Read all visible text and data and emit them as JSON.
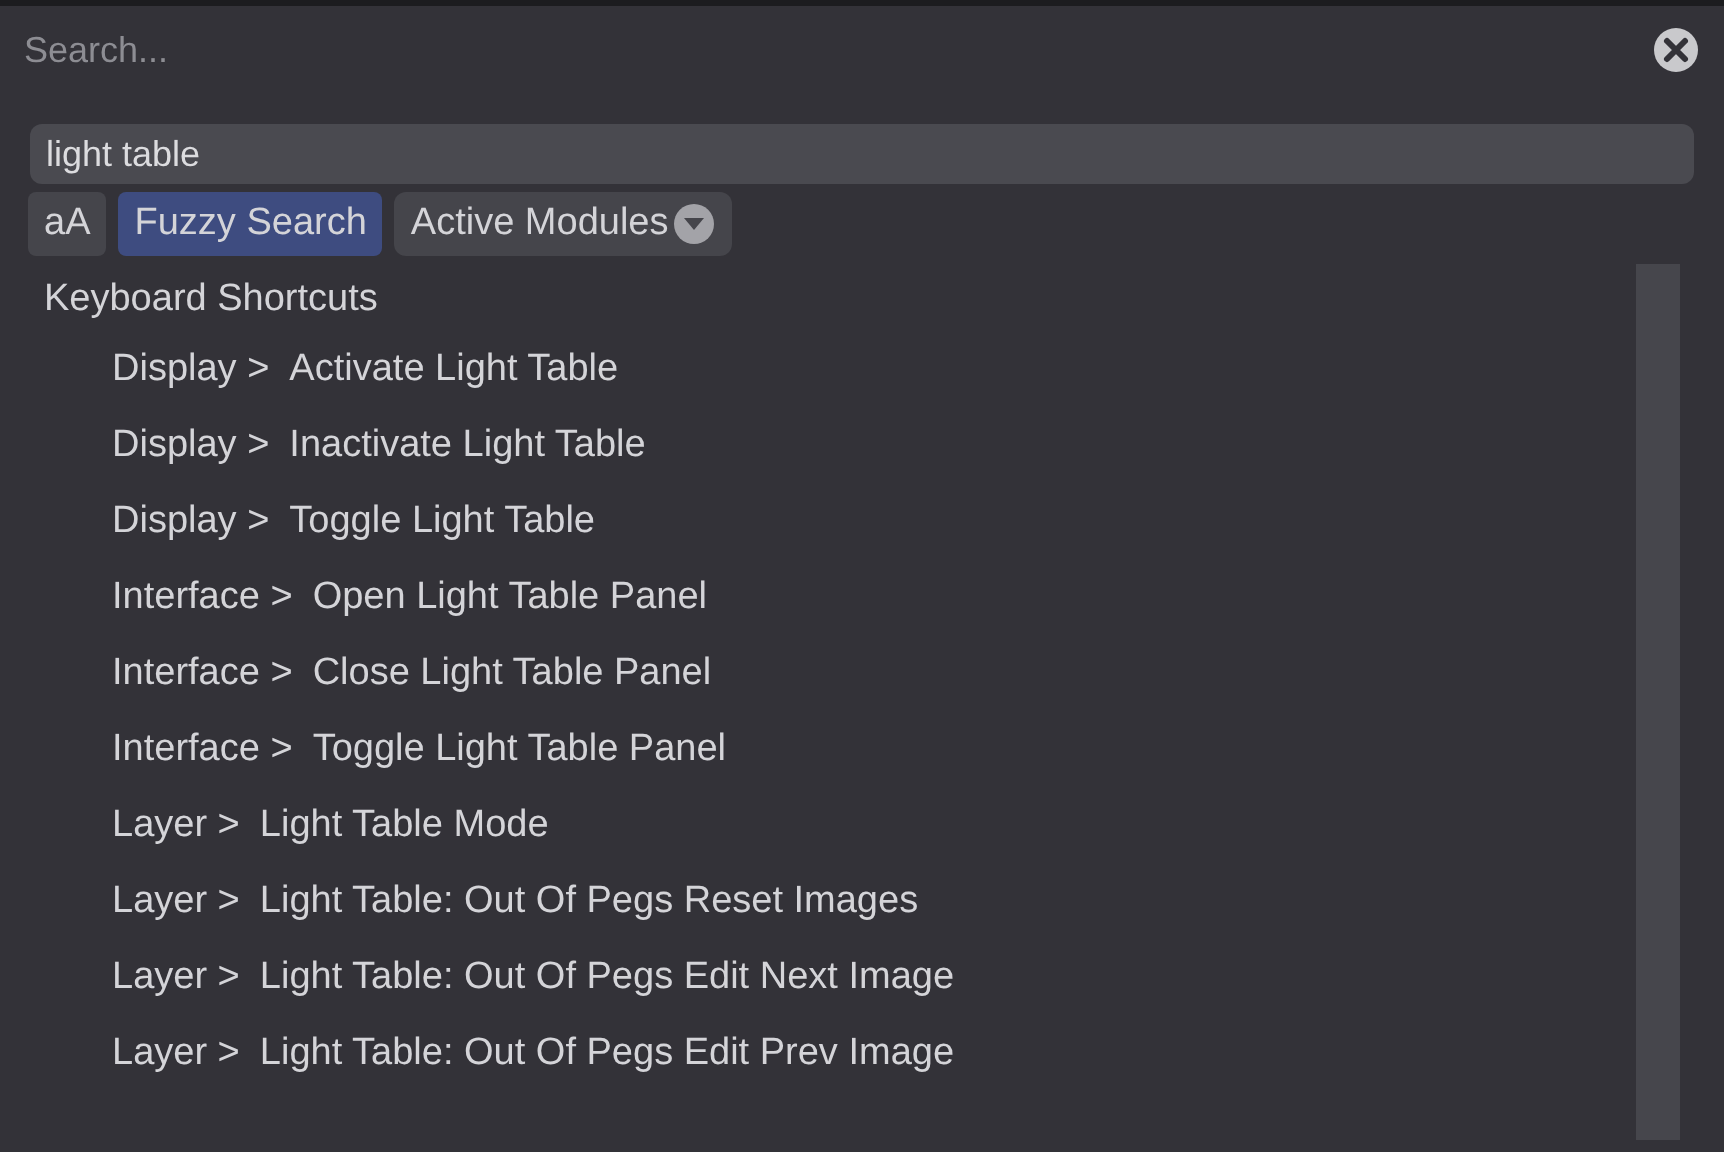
{
  "search": {
    "placeholder": "Search..."
  },
  "query": {
    "value": "light table"
  },
  "options": [
    {
      "label": "aA",
      "kind": "toggle",
      "selected": false
    },
    {
      "label": "Fuzzy Search",
      "kind": "toggle",
      "selected": true
    },
    {
      "label": "Active Modules",
      "kind": "dropdown",
      "selected": false
    }
  ],
  "results": {
    "heading": "Keyboard Shortcuts",
    "items": [
      {
        "path": "Display >",
        "command": "Activate Light Table"
      },
      {
        "path": "Display >",
        "command": "Inactivate Light Table"
      },
      {
        "path": "Display >",
        "command": "Toggle Light Table"
      },
      {
        "path": "Interface >",
        "command": "Open Light Table Panel"
      },
      {
        "path": "Interface >",
        "command": "Close Light Table Panel"
      },
      {
        "path": "Interface >",
        "command": "Toggle Light Table Panel"
      },
      {
        "path": "Layer >",
        "command": "Light Table Mode"
      },
      {
        "path": "Layer >",
        "command": "Light Table: Out Of Pegs Reset Images"
      },
      {
        "path": "Layer >",
        "command": "Light Table: Out Of Pegs Edit Next Image"
      },
      {
        "path": "Layer >",
        "command": "Light Table: Out Of Pegs Edit Prev Image"
      }
    ]
  }
}
